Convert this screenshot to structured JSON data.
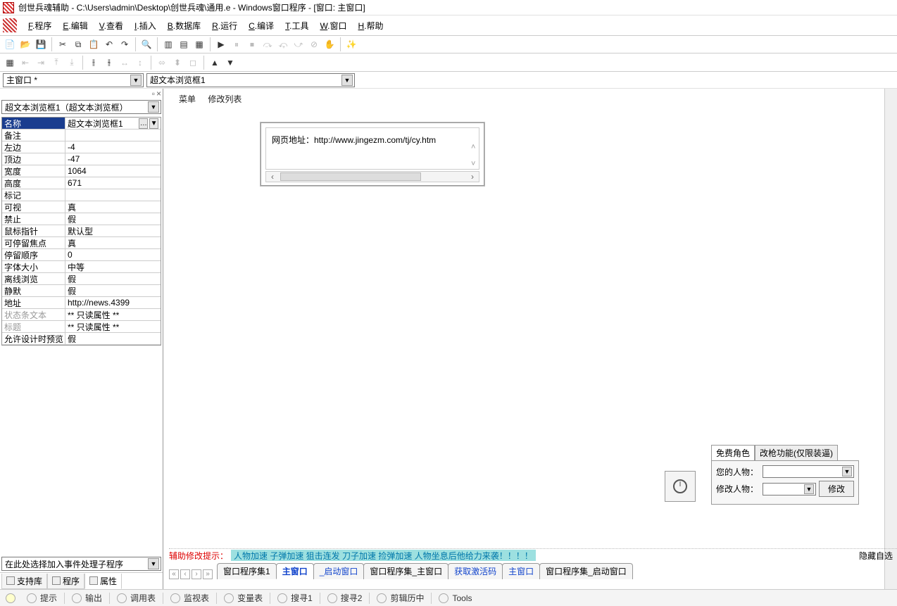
{
  "title": "创世兵魂辅助 - C:\\Users\\admin\\Desktop\\创世兵魂\\通用.e - Windows窗口程序 - [窗口: 主窗口]",
  "menu": {
    "f": "程序",
    "e": "编辑",
    "v": "查看",
    "i": "插入",
    "b": "数据库",
    "r": "运行",
    "c": "编译",
    "t": "工具",
    "w": "窗口",
    "h": "帮助"
  },
  "combo1": "主窗口 *",
  "combo2": "超文本浏览框1",
  "propCombo": "超文本浏览框1（超文本浏览框）",
  "props": [
    {
      "k": "名称",
      "v": "超文本浏览框1",
      "sel": true,
      "dots": true
    },
    {
      "k": "备注",
      "v": ""
    },
    {
      "k": "左边",
      "v": "-4"
    },
    {
      "k": "顶边",
      "v": "-47"
    },
    {
      "k": "宽度",
      "v": "1064"
    },
    {
      "k": "高度",
      "v": "671"
    },
    {
      "k": "标记",
      "v": ""
    },
    {
      "k": "可视",
      "v": "真"
    },
    {
      "k": "禁止",
      "v": "假"
    },
    {
      "k": "鼠标指针",
      "v": "默认型"
    },
    {
      "k": "可停留焦点",
      "v": "真"
    },
    {
      "k": "   停留顺序",
      "v": "0"
    },
    {
      "k": "字体大小",
      "v": "中等"
    },
    {
      "k": "离线浏览",
      "v": "假"
    },
    {
      "k": "静默",
      "v": "假"
    },
    {
      "k": "地址",
      "v": "http://news.4399"
    },
    {
      "k": "状态条文本",
      "v": "** 只读属性 **",
      "dis": true
    },
    {
      "k": "标题",
      "v": "** 只读属性 **",
      "dis": true
    },
    {
      "k": "允许设计时预览",
      "v": "假"
    }
  ],
  "eventCombo": "在此处选择加入事件处理子程序",
  "leftTabs": [
    {
      "l": "支持库"
    },
    {
      "l": "程序"
    },
    {
      "l": "属性",
      "active": true
    }
  ],
  "formMenu": [
    "菜单",
    "修改列表"
  ],
  "browserText": "网页地址：http://www.jingezm.com/tj/cy.htm",
  "redStrip": {
    "lead": "辅助修改提示：",
    "body": "人物加速  子弹加速  狙击连发  刀子加速  捡弹加速  人物坐息后他给力来袭！！！！",
    "tail": "隐藏自选"
  },
  "designTabs": [
    {
      "l": "窗口程序集1"
    },
    {
      "l": "主窗口",
      "active": true
    },
    {
      "l": "_启动窗口",
      "hl": true
    },
    {
      "l": "窗口程序集_主窗口"
    },
    {
      "l": "获取激活码",
      "hl": true
    },
    {
      "l": "主窗口",
      "hl": true
    },
    {
      "l": "窗口程序集_启动窗口"
    }
  ],
  "bp": {
    "tabs": [
      {
        "l": "免费角色",
        "a": true
      },
      {
        "l": "改枪功能(仅限装逼)"
      }
    ],
    "r1": "您的人物：",
    "r2": "修改人物：",
    "btn": "修改"
  },
  "status": [
    {
      "l": "提示"
    },
    {
      "l": "输出"
    },
    {
      "l": "调用表"
    },
    {
      "l": "监视表"
    },
    {
      "l": "变量表"
    },
    {
      "l": "搜寻1"
    },
    {
      "l": "搜寻2"
    },
    {
      "l": "剪辑历中"
    },
    {
      "l": "Tools"
    }
  ]
}
